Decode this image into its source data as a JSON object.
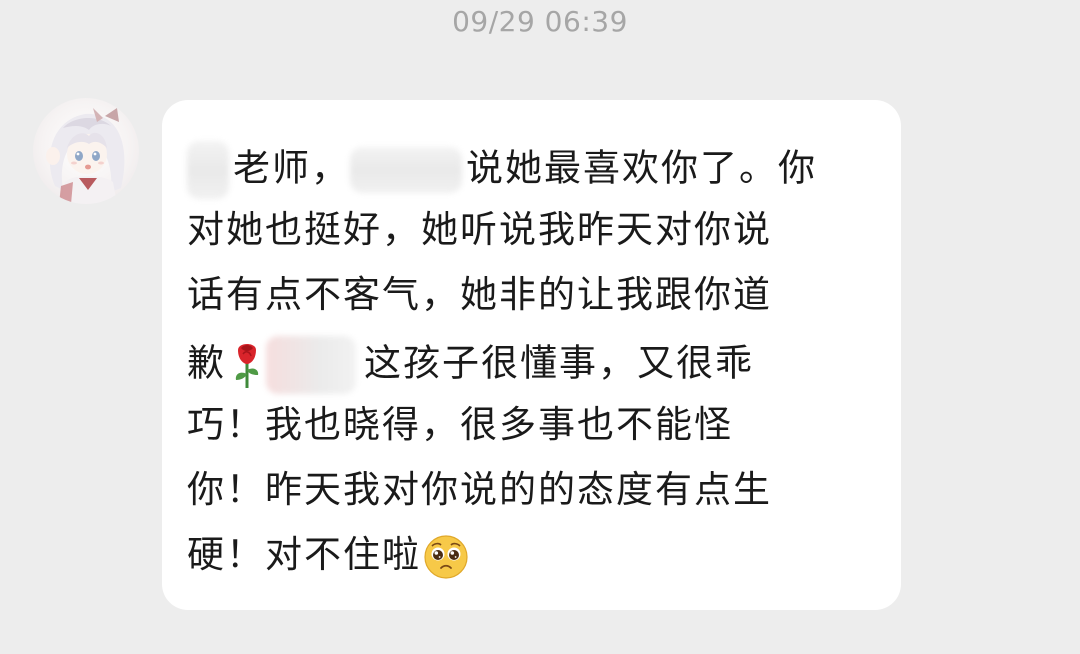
{
  "timestamp": "09/29 06:39",
  "message": {
    "lines": [
      "老师，",
      "说她最喜欢你了。你",
      "对她也挺好，她听说我昨天对你说",
      "话有点不客气，她非的让我跟你道",
      "歉",
      "这孩子很懂事，又很乖",
      "巧！我也晓得，很多事也不能怪",
      "你！昨天我对你说的的态度有点生",
      "硬！对不住啦"
    ]
  },
  "icons": {
    "avatar": "anime-girl-avatar-icon",
    "rose": "rose-emoji-icon",
    "pleading": "pleading-face-emoji-icon"
  },
  "colors": {
    "background": "#ededed",
    "bubble": "#ffffff",
    "text": "#1a1a1a",
    "timestamp": "#a6a6a6"
  }
}
